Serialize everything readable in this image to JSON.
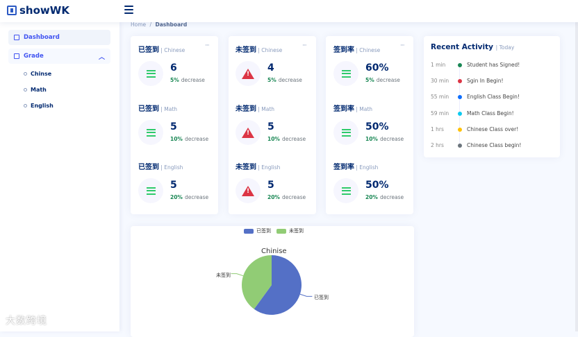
{
  "brand": {
    "name": "showWK"
  },
  "sidebar": {
    "items": [
      {
        "label": "Dashboard",
        "icon": "grid-icon"
      },
      {
        "label": "Grade",
        "icon": "table-icon"
      }
    ],
    "grade_children": [
      "Chinse",
      "Math",
      "English"
    ]
  },
  "breadcrumb": {
    "home": "Home",
    "sep": "/",
    "current": "Dashboard"
  },
  "stats": [
    {
      "title": "已签到",
      "sub": "Chinese",
      "value": "6",
      "pct": "5%",
      "word": "decrease",
      "icon": "menu-lines-icon"
    },
    {
      "title": "未签到",
      "sub": "Chinese",
      "value": "4",
      "pct": "5%",
      "word": "decrease",
      "icon": "warning-icon"
    },
    {
      "title": "签到率",
      "sub": "Chinese",
      "value": "60%",
      "pct": "5%",
      "word": "decrease",
      "icon": "menu-lines-icon"
    },
    {
      "title": "已签到",
      "sub": "Math",
      "value": "5",
      "pct": "10%",
      "word": "decrease",
      "icon": "menu-lines-icon"
    },
    {
      "title": "未签到",
      "sub": "Math",
      "value": "5",
      "pct": "10%",
      "word": "decrease",
      "icon": "warning-icon"
    },
    {
      "title": "签到率",
      "sub": "Math",
      "value": "50%",
      "pct": "10%",
      "word": "decrease",
      "icon": "menu-lines-icon"
    },
    {
      "title": "已签到",
      "sub": "English",
      "value": "5",
      "pct": "20%",
      "word": "decrease",
      "icon": "menu-lines-icon"
    },
    {
      "title": "未签到",
      "sub": "English",
      "value": "5",
      "pct": "20%",
      "word": "decrease",
      "icon": "warning-icon"
    },
    {
      "title": "签到率",
      "sub": "English",
      "value": "50%",
      "pct": "20%",
      "word": "decrease",
      "icon": "menu-lines-icon"
    }
  ],
  "recent_activity": {
    "title": "Recent Activity",
    "sub": "Today",
    "items": [
      {
        "time": "1 min",
        "text": "Student has Signed!",
        "color": "#198754"
      },
      {
        "time": "30 min",
        "text": "Sgin In Begin!",
        "color": "#dc3545"
      },
      {
        "time": "55 min",
        "text": "English Class Begin!",
        "color": "#0d6efd"
      },
      {
        "time": "59 min",
        "text": "Math Class Begin!",
        "color": "#0dcaf0"
      },
      {
        "time": "1 hrs",
        "text": "Chinese Class over!",
        "color": "#ffc107"
      },
      {
        "time": "2 hrs",
        "text": "Chinese Class begin!",
        "color": "#6c757d"
      }
    ]
  },
  "chart_data": {
    "type": "pie",
    "title": "Chinise",
    "legend": [
      "已签到",
      "未签到"
    ],
    "slices": [
      {
        "name": "已签到",
        "value": 6,
        "color": "#5470c6"
      },
      {
        "name": "未签到",
        "value": 4,
        "color": "#91cc75"
      }
    ],
    "legend_position": "top-center"
  },
  "watermark": "大数跨境"
}
